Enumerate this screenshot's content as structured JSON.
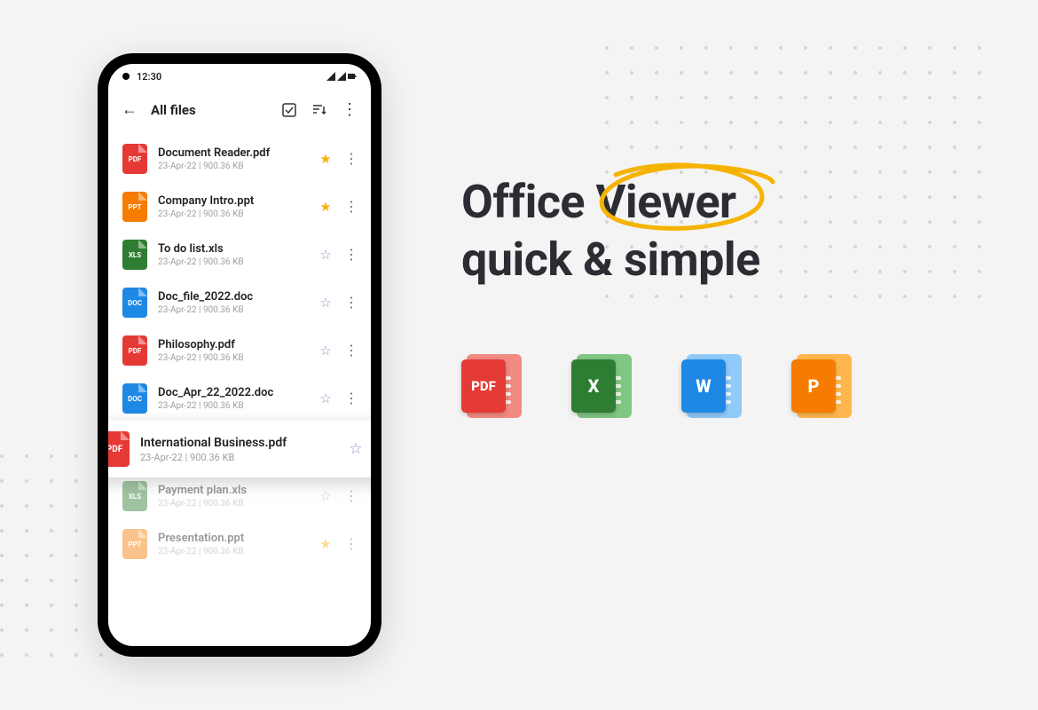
{
  "statusbar": {
    "time": "12:30"
  },
  "toolbar": {
    "title": "All files"
  },
  "files": [
    {
      "name": "Document Reader.pdf",
      "meta": "23-Apr-22 | 900.36 KB",
      "type": "pdf",
      "starred": true
    },
    {
      "name": "Company Intro.ppt",
      "meta": "23-Apr-22 | 900.36 KB",
      "type": "ppt",
      "starred": true
    },
    {
      "name": "To do list.xls",
      "meta": "23-Apr-22 | 900.36 KB",
      "type": "xls",
      "starred": false
    },
    {
      "name": "Doc_file_2022.doc",
      "meta": "23-Apr-22 | 900.36 KB",
      "type": "doc",
      "starred": false
    },
    {
      "name": "Philosophy.pdf",
      "meta": "23-Apr-22 | 900.36 KB",
      "type": "pdf",
      "starred": false
    },
    {
      "name": "Doc_Apr_22_2022.doc",
      "meta": "23-Apr-22 | 900.36 KB",
      "type": "doc",
      "starred": false
    },
    {
      "name": "International Business.pdf",
      "meta": "23-Apr-22 | 900.36 KB",
      "type": "pdf",
      "starred": false,
      "popout": true
    },
    {
      "name": "Payment plan.xls",
      "meta": "23-Apr-22 | 900.36 KB",
      "type": "xls",
      "starred": false,
      "faded": true
    },
    {
      "name": "Presentation.ppt",
      "meta": "23-Apr-22 | 900.36 KB",
      "type": "ppt",
      "starred": true,
      "faded": true
    }
  ],
  "typeLabels": {
    "pdf": "PDF",
    "ppt": "PPT",
    "xls": "XLS",
    "doc": "DOC"
  },
  "headline": {
    "word1": "Office",
    "word2": "Viewer",
    "line2": "quick & simple"
  },
  "formatBadges": {
    "pdf": "PDF",
    "xls": "X",
    "doc": "W",
    "ppt": "P"
  }
}
